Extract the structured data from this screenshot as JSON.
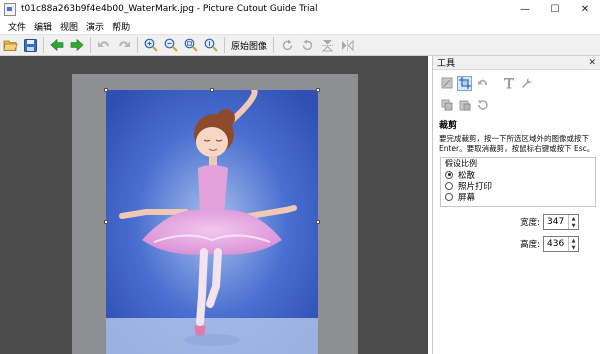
{
  "window": {
    "title": "t01c88a263b9f4e4b00_WaterMark.jpg - Picture Cutout Guide Trial",
    "minimize": "—",
    "maximize": "☐",
    "close": "✕"
  },
  "menu": [
    "文件",
    "编辑",
    "视图",
    "演示",
    "帮助"
  ],
  "toolbar": {
    "original_image_label": "原始图像"
  },
  "panel": {
    "title": "工具",
    "close": "✕",
    "section_title": "裁剪",
    "description": "要完成裁剪，按一下所选区域外的图像或按下 Enter。要取消裁剪，按鼠标右键或按下 Esc。",
    "ratio_legend": "假设比例",
    "ratio_options": [
      "松散",
      "照片打印",
      "屏幕"
    ],
    "selected_ratio": "松散",
    "width_label": "宽度:",
    "width_value": "347",
    "height_label": "高度:",
    "height_value": "436"
  },
  "colors": {
    "canvas_bg": "#4b4b4b",
    "accent_blue": "#3a7bd5",
    "arrow_green": "#2fa82f"
  }
}
